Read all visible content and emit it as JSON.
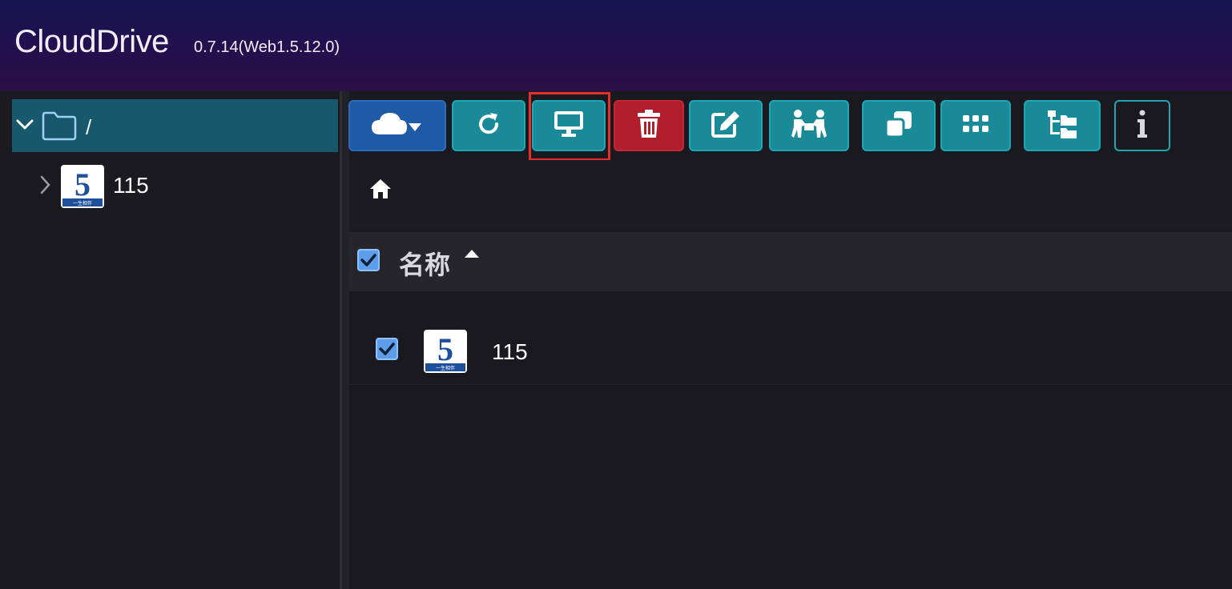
{
  "header": {
    "title": "CloudDrive",
    "version": "0.7.14(Web1.5.12.0)"
  },
  "sidebar": {
    "root": {
      "label": "/"
    },
    "items": [
      {
        "label": "115",
        "logo_text": "5",
        "logo_sub": "一生相伴"
      }
    ]
  },
  "toolbar": {
    "buttons": [
      {
        "name": "cloud-add",
        "icon": "cloud-dropdown-icon"
      },
      {
        "name": "refresh",
        "icon": "refresh-icon"
      },
      {
        "name": "mount",
        "icon": "monitor-icon",
        "highlighted": true
      },
      {
        "name": "delete",
        "icon": "trash-icon"
      },
      {
        "name": "rename",
        "icon": "edit-icon"
      },
      {
        "name": "share",
        "icon": "people-transfer-icon"
      },
      {
        "name": "copy",
        "icon": "copy-icon"
      },
      {
        "name": "view",
        "icon": "grid-icon"
      },
      {
        "name": "tree",
        "icon": "folder-tree-icon"
      },
      {
        "name": "info",
        "icon": "info-icon"
      }
    ]
  },
  "list": {
    "header": {
      "name_label": "名称"
    },
    "rows": [
      {
        "name": "115",
        "logo_text": "5",
        "logo_sub": "一生相伴",
        "checked": true
      }
    ]
  },
  "colors": {
    "accent_teal": "#1a8a98",
    "accent_blue": "#1e5aa5",
    "danger": "#b11e2b",
    "highlight": "#e2302b",
    "selected_row": "#17586c"
  }
}
